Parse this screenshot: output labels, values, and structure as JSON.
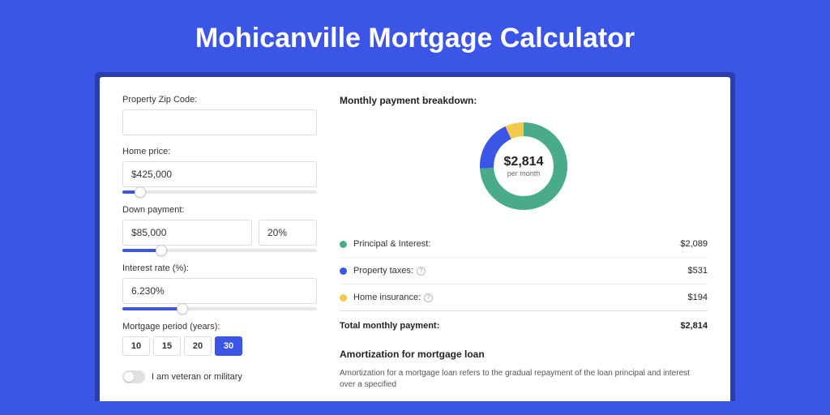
{
  "title": "Mohicanville Mortgage Calculator",
  "form": {
    "zip": {
      "label": "Property Zip Code:",
      "value": ""
    },
    "home_price": {
      "label": "Home price:",
      "value": "$425,000",
      "slider_pct": 9
    },
    "down_payment": {
      "label": "Down payment:",
      "value": "$85,000",
      "pct": "20%",
      "slider_pct": 20
    },
    "interest": {
      "label": "Interest rate (%):",
      "value": "6.230%",
      "slider_pct": 31
    },
    "period": {
      "label": "Mortgage period (years):",
      "options": [
        "10",
        "15",
        "20",
        "30"
      ],
      "selected": "30"
    },
    "veteran": {
      "label": "I am veteran or military",
      "checked": false
    }
  },
  "breakdown": {
    "title": "Monthly payment breakdown:",
    "center_value": "$2,814",
    "center_sub": "per month",
    "items": [
      {
        "label": "Principal & Interest:",
        "value": "$2,089",
        "color": "#4aab8a",
        "has_help": false,
        "pct": 74
      },
      {
        "label": "Property taxes:",
        "value": "$531",
        "color": "#3b55e6",
        "has_help": true,
        "pct": 19
      },
      {
        "label": "Home insurance:",
        "value": "$194",
        "color": "#f1c94c",
        "has_help": true,
        "pct": 7
      }
    ],
    "total": {
      "label": "Total monthly payment:",
      "value": "$2,814"
    }
  },
  "amort": {
    "title": "Amortization for mortgage loan",
    "text": "Amortization for a mortgage loan refers to the gradual repayment of the loan principal and interest over a specified"
  }
}
